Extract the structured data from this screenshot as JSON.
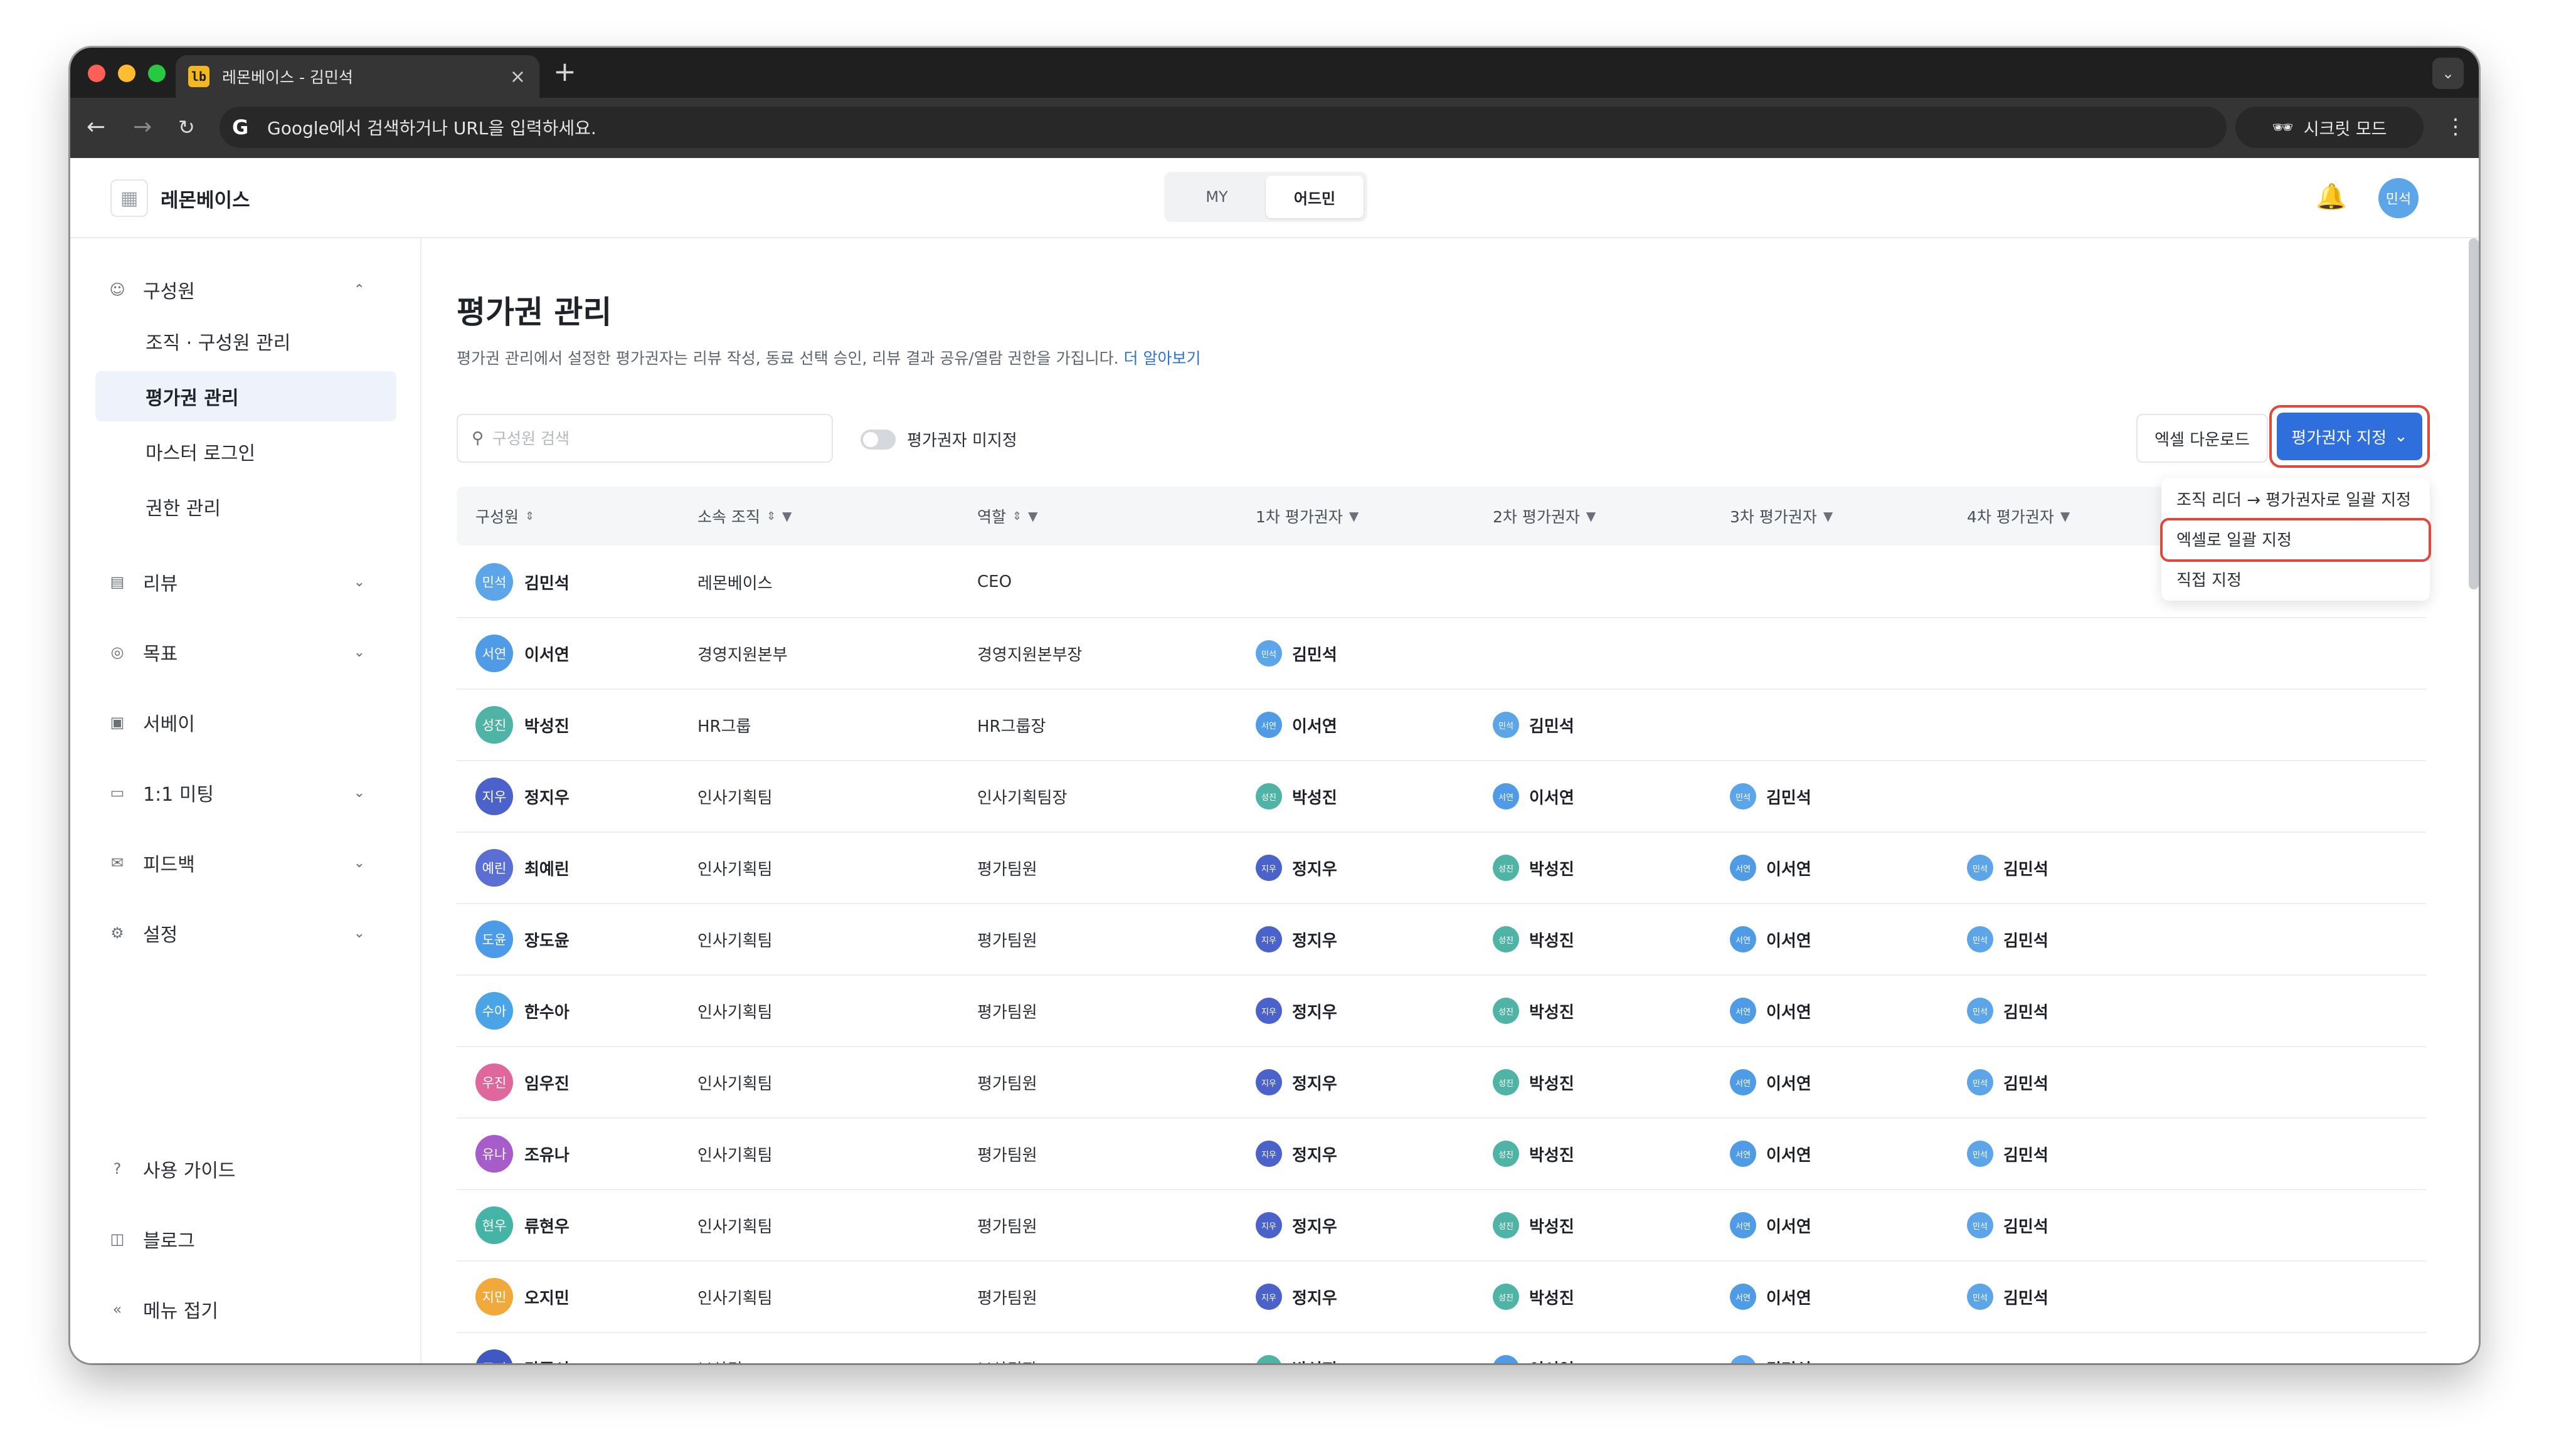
{
  "browser": {
    "tab_title": "레몬베이스 - 김민석",
    "favicon_text": "lb",
    "new_tab": "+",
    "omnibox_placeholder": "Google에서 검색하거나 URL을 입력하세요.",
    "incognito_label": "시크릿 모드"
  },
  "header": {
    "logo_text": "레몬베이스",
    "seg_my": "MY",
    "seg_admin": "어드민",
    "avatar": "민석"
  },
  "sidebar": {
    "members": "구성원",
    "org_manage": "조직 · 구성원 관리",
    "evaluator_manage": "평가권 관리",
    "master_login": "마스터 로그인",
    "permission_manage": "권한 관리",
    "review": "리뷰",
    "goal": "목표",
    "survey": "서베이",
    "meeting": "1:1 미팅",
    "feedback": "피드백",
    "settings": "설정",
    "guide": "사용 가이드",
    "blog": "블로그",
    "collapse": "메뉴 접기"
  },
  "page": {
    "title": "평가권 관리",
    "description": "평가권 관리에서 설정한 평가권자는 리뷰 작성, 동료 선택 승인, 리뷰 결과 공유/열람 권한을 가집니다.",
    "learn_more": "더 알아보기",
    "search_placeholder": "구성원 검색",
    "toggle_label": "평가권자 미지정",
    "excel_download": "엑셀 다운로드",
    "assign_button": "평가권자 지정"
  },
  "dropdown": {
    "item1": "조직 리더 → 평가권자로 일괄 지정",
    "item2": "엑셀로 일괄 지정",
    "item3": "직접 지정"
  },
  "table": {
    "headers": [
      "구성원",
      "소속 조직",
      "역할",
      "1차 평가권자",
      "2차 평가권자",
      "3차 평가권자",
      "4차 평가권자"
    ],
    "rows": [
      {
        "avatar": "민석",
        "name": "김민석",
        "org": "레몬베이스",
        "role": "CEO",
        "e1": "",
        "e1a": "",
        "e2": "",
        "e2a": "",
        "e3": "",
        "e3a": "",
        "e4": "",
        "e4a": ""
      },
      {
        "avatar": "서연",
        "name": "이서연",
        "org": "경영지원본부",
        "role": "경영지원본부장",
        "e1": "김민석",
        "e1a": "민석",
        "e2": "",
        "e2a": "",
        "e3": "",
        "e3a": "",
        "e4": "",
        "e4a": ""
      },
      {
        "avatar": "성진",
        "name": "박성진",
        "org": "HR그룹",
        "role": "HR그룹장",
        "e1": "이서연",
        "e1a": "서연",
        "e2": "김민석",
        "e2a": "민석",
        "e3": "",
        "e3a": "",
        "e4": "",
        "e4a": ""
      },
      {
        "avatar": "지우",
        "name": "정지우",
        "org": "인사기획팀",
        "role": "인사기획팀장",
        "e1": "박성진",
        "e1a": "성진",
        "e2": "이서연",
        "e2a": "서연",
        "e3": "김민석",
        "e3a": "민석",
        "e4": "",
        "e4a": ""
      },
      {
        "avatar": "예린",
        "name": "최예린",
        "org": "인사기획팀",
        "role": "평가팀원",
        "e1": "정지우",
        "e1a": "지우",
        "e2": "박성진",
        "e2a": "성진",
        "e3": "이서연",
        "e3a": "서연",
        "e4": "김민석",
        "e4a": "민석"
      },
      {
        "avatar": "도윤",
        "name": "장도윤",
        "org": "인사기획팀",
        "role": "평가팀원",
        "e1": "정지우",
        "e1a": "지우",
        "e2": "박성진",
        "e2a": "성진",
        "e3": "이서연",
        "e3a": "서연",
        "e4": "김민석",
        "e4a": "민석"
      },
      {
        "avatar": "수아",
        "name": "한수아",
        "org": "인사기획팀",
        "role": "평가팀원",
        "e1": "정지우",
        "e1a": "지우",
        "e2": "박성진",
        "e2a": "성진",
        "e3": "이서연",
        "e3a": "서연",
        "e4": "김민석",
        "e4a": "민석"
      },
      {
        "avatar": "우진",
        "name": "임우진",
        "org": "인사기획팀",
        "role": "평가팀원",
        "e1": "정지우",
        "e1a": "지우",
        "e2": "박성진",
        "e2a": "성진",
        "e3": "이서연",
        "e3a": "서연",
        "e4": "김민석",
        "e4a": "민석"
      },
      {
        "avatar": "유나",
        "name": "조유나",
        "org": "인사기획팀",
        "role": "평가팀원",
        "e1": "정지우",
        "e1a": "지우",
        "e2": "박성진",
        "e2a": "성진",
        "e3": "이서연",
        "e3a": "서연",
        "e4": "김민석",
        "e4a": "민석"
      },
      {
        "avatar": "현우",
        "name": "류현우",
        "org": "인사기획팀",
        "role": "평가팀원",
        "e1": "정지우",
        "e1a": "지우",
        "e2": "박성진",
        "e2a": "성진",
        "e3": "이서연",
        "e3a": "서연",
        "e4": "김민석",
        "e4a": "민석"
      },
      {
        "avatar": "지민",
        "name": "오지민",
        "org": "인사기획팀",
        "role": "평가팀원",
        "e1": "정지우",
        "e1a": "지우",
        "e2": "박성진",
        "e2a": "성진",
        "e3": "이서연",
        "e3a": "서연",
        "e4": "김민석",
        "e4a": "민석"
      },
      {
        "avatar": "준서",
        "name": "강준서",
        "org": "보상팀",
        "role": "보상팀장",
        "e1": "박성진",
        "e1a": "성진",
        "e2": "이서연",
        "e2a": "서연",
        "e3": "김민석",
        "e3a": "민석",
        "e4": "",
        "e4a": ""
      }
    ]
  },
  "colors": {
    "민석": "#5ba5e8",
    "서연": "#4f9be6",
    "성진": "#4fb3a6",
    "지우": "#4a62c9",
    "예린": "#5a6fd3",
    "도윤": "#4b9be8",
    "수아": "#4aa4e6",
    "우진": "#e0679c",
    "유나": "#a65cc9",
    "현우": "#44b4a6",
    "지민": "#f0a93a",
    "준서": "#3f58c2",
    "accent": "#2f6fdc",
    "highlight": "#e0483c"
  },
  "help_icon": "question-icon"
}
